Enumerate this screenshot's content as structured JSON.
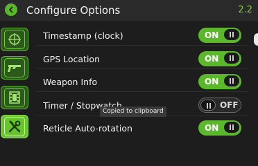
{
  "header": {
    "title": "Configure Options",
    "version": "2.2"
  },
  "sidebar": {
    "items": [
      {
        "icon": "crosshair-icon",
        "active": false
      },
      {
        "icon": "rifle-icon",
        "active": false
      },
      {
        "icon": "film-icon",
        "active": false
      },
      {
        "icon": "tools-icon",
        "active": true
      }
    ]
  },
  "options": [
    {
      "label": "Timestamp (clock)",
      "state": "ON"
    },
    {
      "label": "GPS Location",
      "state": "ON"
    },
    {
      "label": "Weapon Info",
      "state": "ON"
    },
    {
      "label": "Timer / Stopwatch",
      "state": "OFF"
    },
    {
      "label": "Reticle Auto-rotation",
      "state": "ON"
    }
  ],
  "toast": {
    "text": "Copied to clipboard"
  },
  "colors": {
    "accent": "#5cb82b",
    "background": "#1d1d1d",
    "version": "#7ed321"
  }
}
